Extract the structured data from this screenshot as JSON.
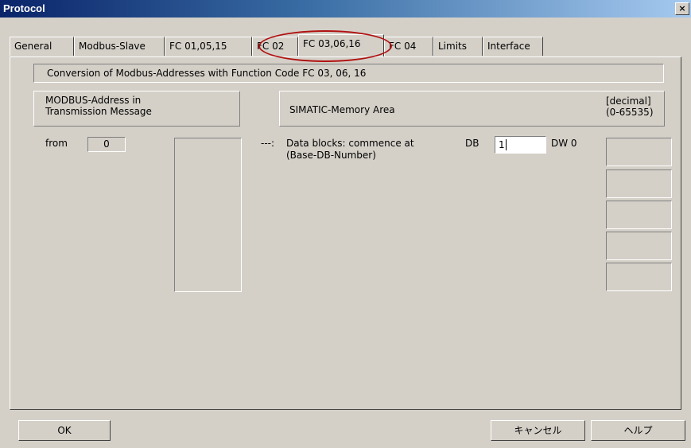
{
  "window": {
    "title": "Protocol",
    "close_symbol": "×"
  },
  "tabs": [
    {
      "label": "General"
    },
    {
      "label": "Modbus-Slave"
    },
    {
      "label": "FC 01,05,15"
    },
    {
      "label": "FC 02"
    },
    {
      "label": "FC 03,06,16"
    },
    {
      "label": "FC 04"
    },
    {
      "label": "Limits"
    },
    {
      "label": "Interface"
    }
  ],
  "active_tab": "FC 03,06,16",
  "panel": {
    "header": "Conversion of  Modbus-Addresses  with  Function Code  FC 03, 06, 16",
    "modbus_address_box": "MODBUS-Address in\nTransmission Message",
    "simatic_label": "SIMATIC-Memory Area",
    "decimal_label": "[decimal]\n(0-65535)",
    "from_label": "from",
    "from_value": "0",
    "arrow": "---:",
    "data_blocks_label": "Data blocks:    commence at",
    "base_db_label": "(Base-DB-Number)",
    "db_label": "DB",
    "db_value": "1",
    "dw_label": "DW 0"
  },
  "buttons": {
    "ok": "OK",
    "cancel": "キャンセル",
    "help": "ヘルプ"
  },
  "colors": {
    "highlight_circle": "#b01010",
    "titlebar": "#0a246a"
  }
}
